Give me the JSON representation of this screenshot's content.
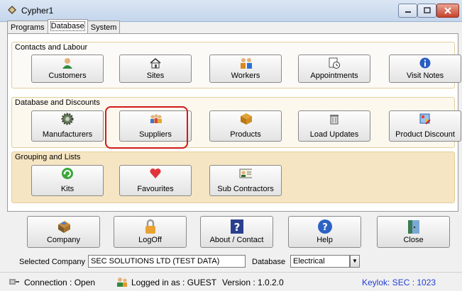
{
  "window": {
    "title": "Cypher1"
  },
  "tabs": [
    {
      "label": "Programs"
    },
    {
      "label": "Database"
    },
    {
      "label": "System"
    }
  ],
  "groups": {
    "contacts": {
      "label": "Contacts and Labour",
      "buttons": [
        {
          "label": "Customers",
          "icon": "customer-icon"
        },
        {
          "label": "Sites",
          "icon": "house-icon"
        },
        {
          "label": "Workers",
          "icon": "workers-icon"
        },
        {
          "label": "Appointments",
          "icon": "clock-icon"
        },
        {
          "label": "Visit Notes",
          "icon": "info-icon"
        }
      ]
    },
    "database": {
      "label": "Database and Discounts",
      "buttons": [
        {
          "label": "Manufacturers",
          "icon": "gear-icon"
        },
        {
          "label": "Suppliers",
          "icon": "people-icon"
        },
        {
          "label": "Products",
          "icon": "box-icon"
        },
        {
          "label": "Load Updates",
          "icon": "bin-icon"
        },
        {
          "label": "Product Discount",
          "icon": "discount-icon"
        }
      ]
    },
    "grouping": {
      "label": "Grouping and Lists",
      "buttons": [
        {
          "label": "Kits",
          "icon": "refresh-icon"
        },
        {
          "label": "Favourites",
          "icon": "heart-icon"
        },
        {
          "label": "Sub Contractors",
          "icon": "contact-card-icon"
        }
      ]
    }
  },
  "bottom_buttons": [
    {
      "label": "Company",
      "icon": "company-icon"
    },
    {
      "label": "LogOff",
      "icon": "padlock-icon"
    },
    {
      "label": "About / Contact",
      "icon": "question-icon"
    },
    {
      "label": "Help",
      "icon": "help-icon"
    },
    {
      "label": "Close",
      "icon": "door-icon"
    }
  ],
  "selection": {
    "company_label": "Selected Company",
    "company_value": "SEC SOLUTIONS LTD (TEST DATA)",
    "database_label": "Database",
    "database_value": "Electrical"
  },
  "status": {
    "connection": "Connection : Open",
    "logged_in": "Logged in as : GUEST",
    "version": "Version : 1.0.2.0",
    "keylok": "Keylok: SEC : 1023"
  },
  "colors": {
    "highlight": "#d11a1a",
    "keylok_text": "#1f3fd0"
  }
}
